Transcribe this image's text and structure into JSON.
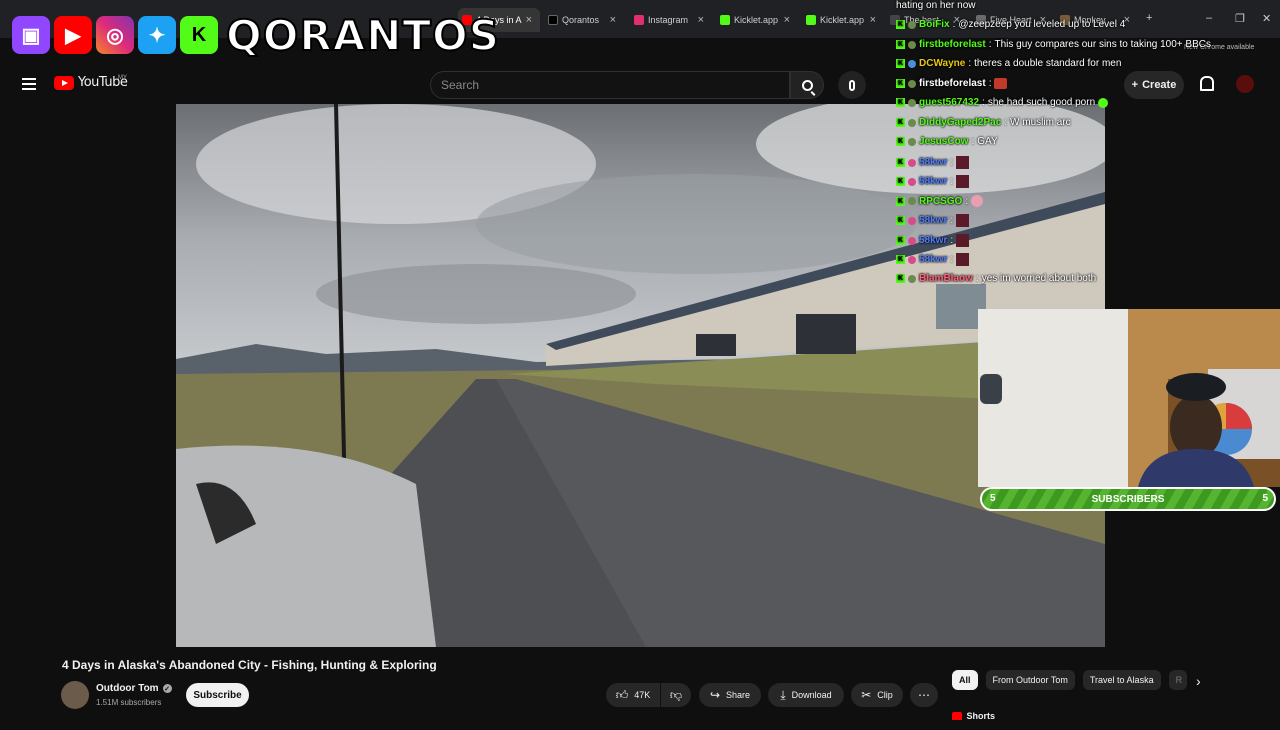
{
  "browser": {
    "tabs": [
      {
        "label": "4 Days in A",
        "favicon_color": "#ff0000",
        "active": true
      },
      {
        "label": "Qorantos",
        "favicon_color": "#000000",
        "active": false
      },
      {
        "label": "Instagram",
        "favicon_color": "#e1306c",
        "active": false
      },
      {
        "label": "Kicklet.app",
        "favicon_color": "#53fc18",
        "active": false
      },
      {
        "label": "Kicklet.app",
        "favicon_color": "#53fc18",
        "active": false
      },
      {
        "label": "The best",
        "favicon_color": "#444444",
        "active": false
      },
      {
        "label": "Five Heart",
        "favicon_color": "#6b6b6b",
        "active": false
      },
      {
        "label": "Monkey",
        "favicon_color": "#7a5c3a",
        "active": false
      }
    ],
    "update_notice": "New Chrome available"
  },
  "overlay": {
    "brand": "QORANTOS",
    "logos": [
      "twitch-icon",
      "youtube-icon",
      "instagram-icon",
      "twitter-icon",
      "kick-icon"
    ]
  },
  "header": {
    "logo_text": "YouTube",
    "region": "MY",
    "search_placeholder": "Search",
    "create_label": "Create"
  },
  "chat": {
    "top_text": "hating on her now",
    "messages": [
      {
        "name": "BoiFix",
        "text": "@zeepzeep you leveled up to Level 4",
        "color": "#53fc18"
      },
      {
        "name": "firstbeforelast",
        "text": "This guy compares our sins to taking 100+ BBCs",
        "color": "#53fc18"
      },
      {
        "name": "DCWayne",
        "text": "theres a double standard for men",
        "color": "#e6c619"
      },
      {
        "name": "firstbeforelast",
        "text": "",
        "color": "#ffffff"
      },
      {
        "name": "guest567432",
        "text": "she had such good porn",
        "color": "#53fc18"
      },
      {
        "name": "DiddyGaped2Pac",
        "text": "W muslim arc",
        "color": "#53fc18"
      },
      {
        "name": "JesusCow",
        "text": "GAY",
        "color": "#53fc18"
      },
      {
        "name": "58kwr",
        "text": "",
        "color": "#4f7cff"
      },
      {
        "name": "58kwr",
        "text": "",
        "color": "#4f7cff"
      },
      {
        "name": "RPCSGO",
        "text": "",
        "color": "#53fc18"
      },
      {
        "name": "58kwr",
        "text": "",
        "color": "#4f7cff"
      },
      {
        "name": "58kwr",
        "text": "",
        "color": "#4f7cff"
      },
      {
        "name": "58kwr",
        "text": "",
        "color": "#4f7cff"
      },
      {
        "name": "BlamBlaow",
        "text": "yes im worried about both",
        "color": "#ff5f7a"
      }
    ]
  },
  "subscriber_bar": {
    "label": "SUBSCRIBERS",
    "left": "5",
    "right": "5"
  },
  "video": {
    "title": "4 Days in Alaska's Abandoned City - Fishing, Hunting & Exploring",
    "channel": "Outdoor Tom",
    "subscribers": "1.51M subscribers",
    "subscribe_label": "Subscribe",
    "likes": "47K",
    "share_label": "Share",
    "download_label": "Download",
    "clip_label": "Clip"
  },
  "chips": [
    "All",
    "From Outdoor Tom",
    "Travel to Alaska",
    "R"
  ],
  "shorts_label": "Shorts"
}
